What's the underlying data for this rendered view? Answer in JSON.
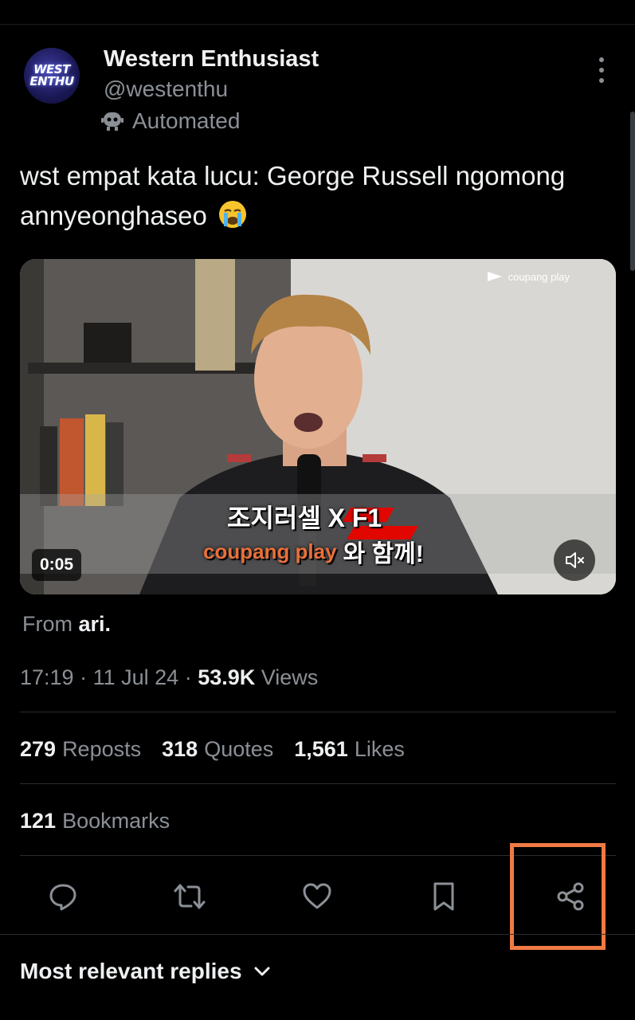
{
  "post": {
    "author_name": "Western Enthusiast",
    "author_handle": "@westenthu",
    "automated_label": "Automated",
    "avatar_text": "WEST\nENTHU",
    "text": "wst empat kata lucu: George Russell ngomong annyeonghaseo",
    "emoji": "loudly-crying-face-emoji"
  },
  "media": {
    "watermark": "coupang play",
    "duration": "0:05",
    "subtitle_line1": "조지러셀 X F1",
    "subtitle_brand": "coupang play",
    "subtitle_line2": "와 함께!",
    "mute_icon": "speaker-muted-icon"
  },
  "source": {
    "label": "From",
    "name": "ari."
  },
  "meta": {
    "time": "17:19",
    "date": "11 Jul 24",
    "views_count": "53.9K",
    "views_label": "Views"
  },
  "stats": {
    "reposts_count": "279",
    "reposts_label": "Reposts",
    "quotes_count": "318",
    "quotes_label": "Quotes",
    "likes_count": "1,561",
    "likes_label": "Likes",
    "bookmarks_count": "121",
    "bookmarks_label": "Bookmarks"
  },
  "actions": [
    "reply-icon",
    "repost-icon",
    "like-icon",
    "bookmark-icon",
    "share-icon"
  ],
  "replies_sort": {
    "label": "Most relevant replies"
  },
  "colors": {
    "background": "#000000",
    "text_primary": "#eef0f1",
    "text_secondary": "#8b9096",
    "highlight_box": "#f07a44"
  }
}
